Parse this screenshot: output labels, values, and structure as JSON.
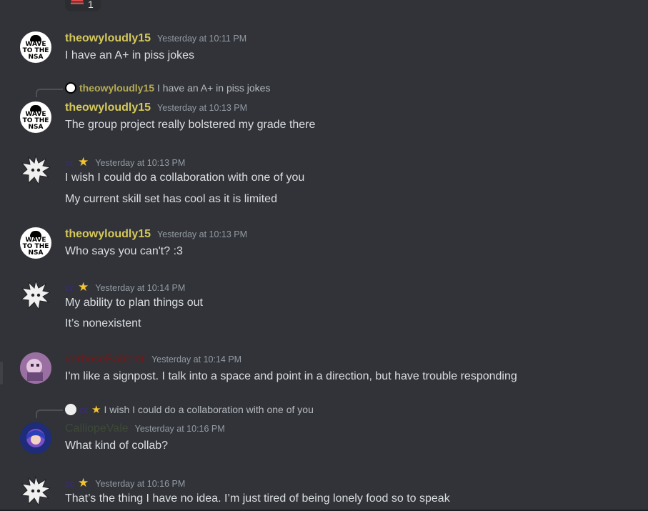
{
  "top_reaction": {
    "count": "1"
  },
  "messages": [
    {
      "user": "theowyloudly15",
      "time": "Yesterday at 10:11 PM",
      "lines": [
        "I have an A+ in piss jokes"
      ]
    },
    {
      "reply": {
        "user": "theowyloudly15",
        "text": "I have an A+ in piss jokes"
      },
      "user": "theowyloudly15",
      "time": "Yesterday at 10:13 PM",
      "lines": [
        "The group project really bolstered my grade there"
      ]
    },
    {
      "user": "cc",
      "time": "Yesterday at 10:13 PM",
      "lines": [
        "I wish I could do a collaboration with one of you",
        "My current skill set has cool as it is limited"
      ]
    },
    {
      "user": "theowyloudly15",
      "time": "Yesterday at 10:13 PM",
      "lines": [
        "Who says you can't? :3"
      ]
    },
    {
      "user": "cc",
      "time": "Yesterday at 10:14 PM",
      "lines": [
        "My ability to plan things out",
        "It’s nonexistent"
      ]
    },
    {
      "user": "verboseBabbler",
      "time": "Yesterday at 10:14 PM",
      "lines": [
        "I'm like a signpost. I talk into a space and point in a direction, but have trouble responding"
      ]
    },
    {
      "reply": {
        "user": "cc",
        "text": "I wish I could do a collaboration with one of you"
      },
      "user": "CalliopeVale",
      "time": "Yesterday at 10:16 PM",
      "lines": [
        "What kind of collab?"
      ]
    },
    {
      "user": "cc",
      "time": "Yesterday at 10:16 PM",
      "lines": [
        "That’s the thing I have no idea. I’m just tired of being lonely food so to speak"
      ]
    }
  ],
  "avatar_labels": {
    "nsa": "WAVE TO THE NSA"
  },
  "colors": {
    "background": "#313338",
    "theo": "#d6c95a",
    "cc": "#3a2b7a",
    "verbose": "#6e1b1b",
    "calliope": "#3e4a36",
    "timestamp": "#949ba4"
  }
}
